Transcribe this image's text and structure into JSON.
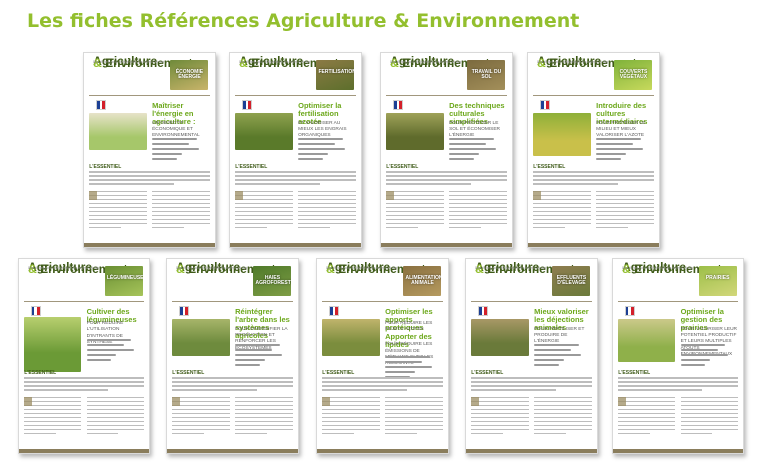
{
  "page": {
    "title": "Les fiches Références Agriculture & Environnement"
  },
  "series": {
    "logo_line1": "Agriculture",
    "logo_line2": "Environnement",
    "ampersand": "&",
    "tagline": "Des fiches pour comprendre les enjeux et agir"
  },
  "colors": {
    "accent_green": "#93bf2e",
    "dark_green": "#3f5b19",
    "band_brown": "#8a7d5c",
    "flag_blue": "#1c3f94",
    "flag_red": "#d3202a"
  },
  "cards": [
    {
      "theme": "ÉCONOMIE ÉNERGIE",
      "title": "Maîtriser l'énergie en agriculture :",
      "subtitle": "un objectif économique et environnemental",
      "essential": "L'ESSENTIEL",
      "thumb_colors": [
        "#6f8a3a",
        "#c9b46a"
      ],
      "photo_colors": [
        "#a6c76a",
        "#e7e3c9"
      ]
    },
    {
      "theme": "FERTILISATION",
      "title": "Optimiser la fertilisation azotée",
      "subtitle": "et valoriser au mieux les engrais organiques",
      "essential": "L'ESSENTIEL",
      "thumb_colors": [
        "#8b7a44",
        "#5d6f2c"
      ],
      "photo_colors": [
        "#5a7a2a",
        "#8fa24f"
      ]
    },
    {
      "theme": "TRAVAIL DU SOL",
      "title": "Des techniques culturales simplifiées",
      "subtitle": "pour protéger le sol et économiser l'énergie",
      "essential": "L'ESSENTIEL",
      "thumb_colors": [
        "#7b6a3e",
        "#a38f5a"
      ],
      "photo_colors": [
        "#5f6b2c",
        "#9fa259"
      ]
    },
    {
      "theme": "COUVERTS VÉGÉTAUX",
      "title": "Introduire des cultures intermédiaires",
      "subtitle": "pour protéger le milieu et mieux valoriser l'azote",
      "essential": "L'ESSENTIEL",
      "thumb_colors": [
        "#7fb23a",
        "#c7d95c"
      ],
      "photo_colors": [
        "#c9c04a",
        "#8fb039"
      ]
    },
    {
      "theme": "LÉGUMINEUSES",
      "title": "Cultiver des légumineuses",
      "subtitle": "pour réduire l'utilisation d'intrants de synthèse",
      "essential": "L'ESSENTIEL",
      "thumb_colors": [
        "#6a8f33",
        "#a6c45a"
      ],
      "photo_colors": [
        "#6b9a36",
        "#b8cf6f"
      ]
    },
    {
      "theme": "HAIES AGROFORESTERIE",
      "title": "Réintégrer l'arbre dans les systèmes agricoles",
      "subtitle": "pour diversifier la production et renforcer les écosystèmes",
      "essential": "L'ESSENTIEL",
      "thumb_colors": [
        "#4f7a2a",
        "#7e9d45"
      ],
      "photo_colors": [
        "#6e8b3d",
        "#a7b56a"
      ]
    },
    {
      "theme": "ALIMENTATION ANIMALE",
      "title": "Optimiser les apports protéiques",
      "title2": "Apporter des lipides",
      "subtitle": "pour réduire les rejets azotés",
      "subtitle2": "pour réduire les émissions de méthane chez les ruminants",
      "essential": "L'ESSENTIEL",
      "thumb_colors": [
        "#8a7040",
        "#b59a5f"
      ],
      "photo_colors": [
        "#7b8d3d",
        "#c0b46c"
      ]
    },
    {
      "theme": "EFFLUENTS D'ÉLEVAGE",
      "title": "Mieux valoriser les déjections animales",
      "subtitle": "pour fertiliser et produire de l'énergie",
      "essential": "L'ESSENTIEL",
      "thumb_colors": [
        "#8e7c4f",
        "#6b7b3b"
      ],
      "photo_colors": [
        "#6a7a3a",
        "#a89866"
      ]
    },
    {
      "theme": "PRAIRIES",
      "title": "Optimiser la gestion des prairies",
      "subtitle": "pour valoriser leur potentiel productif et leurs multiples atouts environnementaux",
      "essential": "L'ESSENTIEL",
      "thumb_colors": [
        "#9cbf48",
        "#d2d77a"
      ],
      "photo_colors": [
        "#8fb04a",
        "#cbc98a"
      ]
    }
  ]
}
